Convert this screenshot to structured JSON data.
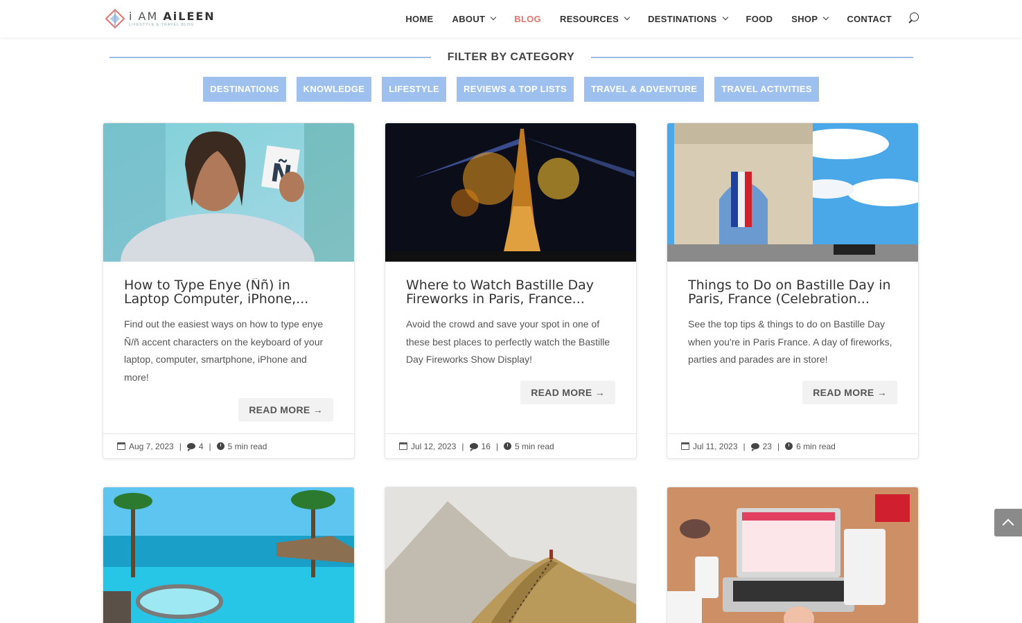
{
  "header": {
    "logo_name_light": "i AM ",
    "logo_name_bold": "AiLEEN",
    "logo_tagline": "LIFESTYLE & TRAVEL BLOG",
    "nav": [
      {
        "label": "HOME",
        "dropdown": false,
        "active": false
      },
      {
        "label": "ABOUT",
        "dropdown": true,
        "active": false
      },
      {
        "label": "BLOG",
        "dropdown": false,
        "active": true
      },
      {
        "label": "RESOURCES",
        "dropdown": true,
        "active": false
      },
      {
        "label": "DESTINATIONS",
        "dropdown": true,
        "active": false
      },
      {
        "label": "FOOD",
        "dropdown": false,
        "active": false
      },
      {
        "label": "SHOP",
        "dropdown": true,
        "active": false
      },
      {
        "label": "CONTACT",
        "dropdown": false,
        "active": false
      }
    ],
    "search_icon": "search-icon"
  },
  "filter": {
    "title": "FILTER BY CATEGORY",
    "categories": [
      "DESTINATIONS",
      "KNOWLEDGE",
      "LIFESTYLE",
      "REVIEWS & TOP LISTS",
      "TRAVEL & ADVENTURE",
      "TRAVEL ACTIVITIES"
    ]
  },
  "posts": [
    {
      "title": "How to Type Enye (Ññ) in Laptop Computer, iPhone,...",
      "excerpt": "Find out the easiest ways on how to type enye Ñ/ñ accent characters on the keyboard of your laptop, computer, smartphone, iPhone and more!",
      "read_more": "READ MORE →",
      "date": "Aug 7, 2023",
      "comments": "4",
      "read_time": "5 min read"
    },
    {
      "title": "Where to Watch Bastille Day Fireworks in Paris, France...",
      "excerpt": "Avoid the crowd and save your spot in one of these best places to perfectly watch the Bastille Day Fireworks Show Display!",
      "read_more": "READ MORE →",
      "date": "Jul 12, 2023",
      "comments": "16",
      "read_time": "5 min read"
    },
    {
      "title": "Things to Do on Bastille Day in Paris, France (Celebration...",
      "excerpt": "See the top tips & things to do on Bastille Day when you're in Paris France. A day of fireworks, parties and parades are in store!",
      "read_more": "READ MORE →",
      "date": "Jul 11, 2023",
      "comments": "23",
      "read_time": "6 min read"
    }
  ],
  "colors": {
    "accent": "#e8736c",
    "category_bg": "#9dc0ee",
    "divider": "#9dbde6"
  }
}
